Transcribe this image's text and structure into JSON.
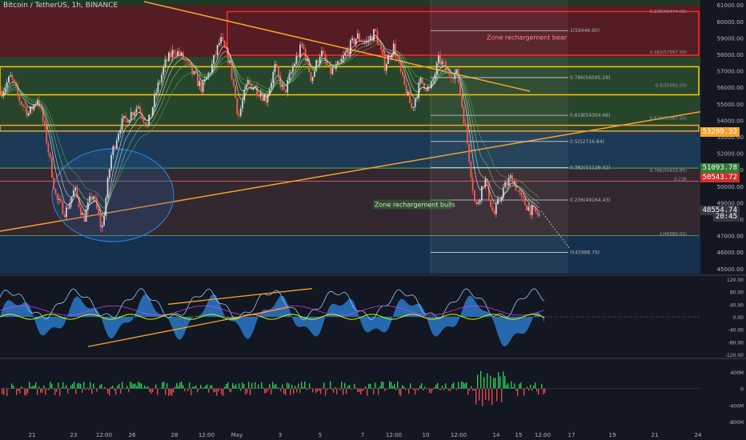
{
  "header": {
    "title": "Bitcoin / TetherUS, 1h, BINANCE"
  },
  "colors": {
    "bg": "#131722",
    "upper_red": "#6b1f24",
    "green_band": "#2a4a2c",
    "mid_blue": "#1c3a55",
    "lower_blue": "#16314d",
    "yellow": "#ffc400",
    "orange": "#f7a22a",
    "red_box": "#ff2b2b",
    "up_candle": "#d1d4dc",
    "down_candle": "#ff5a4c",
    "ema_green": "#4caf50",
    "osc_blue": "#2e86de",
    "vol_green": "#28e05c",
    "vol_red": "#ff4d4d"
  },
  "annotations": {
    "zone_bear": "Zone rechargement bear",
    "zone_bull": "Zone rechargement bulls"
  },
  "chart_data": [
    {
      "type": "line",
      "panel": "price",
      "title": "Bitcoin / TetherUS, 1h, BINANCE",
      "y_ticks": [
        "61000.00",
        "60000.00",
        "59000.00",
        "58000.00",
        "57000.00",
        "56000.00",
        "55000.00",
        "54000.00",
        "53000.00",
        "52000.00",
        "51000.00",
        "50000.00",
        "49000.00",
        "48000.00",
        "47000.00",
        "46000.00",
        "45000.00"
      ],
      "ylim": [
        44700,
        61300
      ],
      "x_ticks": [
        "21",
        "23",
        "12:00",
        "26",
        "28",
        "12:00",
        "May",
        "3",
        "5",
        "7",
        "12:00",
        "10",
        "12:00",
        "14",
        "15",
        "12:00",
        "17",
        "19",
        "21",
        "24"
      ],
      "fib_levels": [
        {
          "label": "1(59444.90)",
          "value": 59444.9
        },
        {
          "label": "0.786(56595.29)",
          "value": 56595.29
        },
        {
          "label": "0.618(54304.66)",
          "value": 54304.66
        },
        {
          "label": "0.5(52716.84)",
          "value": 52716.84
        },
        {
          "label": "0.382(51129.02)",
          "value": 51129.02
        },
        {
          "label": "0.236(49164.43)",
          "value": 49164.43
        },
        {
          "label": "0(45988.79)",
          "value": 45988.79
        }
      ],
      "right_fib_levels": [
        {
          "label": "0.236(60474.05)",
          "value": 60474.05
        },
        {
          "label": "0.382(57997.59)",
          "value": 57997.59
        },
        {
          "label": "0.5(55992.50)",
          "value": 55992.5
        },
        {
          "label": "0.618(53987.50)",
          "value": 53987.5
        },
        {
          "label": "0.786(50815.85)",
          "value": 50815.85
        },
        {
          "label": "0.236",
          "value": 50300
        },
        {
          "label": "1(46980.00)",
          "value": 46980.0
        }
      ],
      "price_tags": [
        {
          "label": "53299.32",
          "value": 53299.32,
          "color": "#f7a22a"
        },
        {
          "label": "51093.78",
          "value": 51093.78,
          "color": "#2e7d32"
        },
        {
          "label": "50543.72",
          "value": 50543.72,
          "color": "#d32f2f"
        },
        {
          "label": "48554.74",
          "value": 48554.74,
          "color": "#363a45"
        },
        {
          "label": "20:45",
          "value": 48150,
          "color": "#363a45"
        }
      ],
      "close_series": [
        55800,
        56600,
        55200,
        54400,
        55400,
        52600,
        49200,
        48400,
        49800,
        48000,
        49600,
        47300,
        51800,
        53700,
        54300,
        54900,
        53600,
        55800,
        57500,
        58300,
        57700,
        56800,
        55900,
        57200,
        58900,
        57600,
        54200,
        56300,
        55900,
        55300,
        57200,
        55600,
        57300,
        58600,
        56500,
        58200,
        56900,
        57300,
        58300,
        59100,
        58700,
        59400,
        57300,
        58500,
        56400,
        54700,
        56400,
        55800,
        57700,
        56900,
        56800,
        53100,
        48600,
        50500,
        48200,
        49800,
        50600,
        49200,
        48600,
        48200
      ]
    },
    {
      "type": "line",
      "panel": "oscillator",
      "y_ticks": [
        "120.00",
        "80.00",
        "40.00",
        "0.00",
        "-40.00",
        "-80.00",
        "-120.00"
      ],
      "ylim": [
        -125,
        125
      ]
    },
    {
      "type": "bar",
      "panel": "volume",
      "y_ticks": [
        "400M",
        "0",
        "-400M",
        "-800M"
      ],
      "ylim": [
        -950,
        650
      ]
    }
  ]
}
